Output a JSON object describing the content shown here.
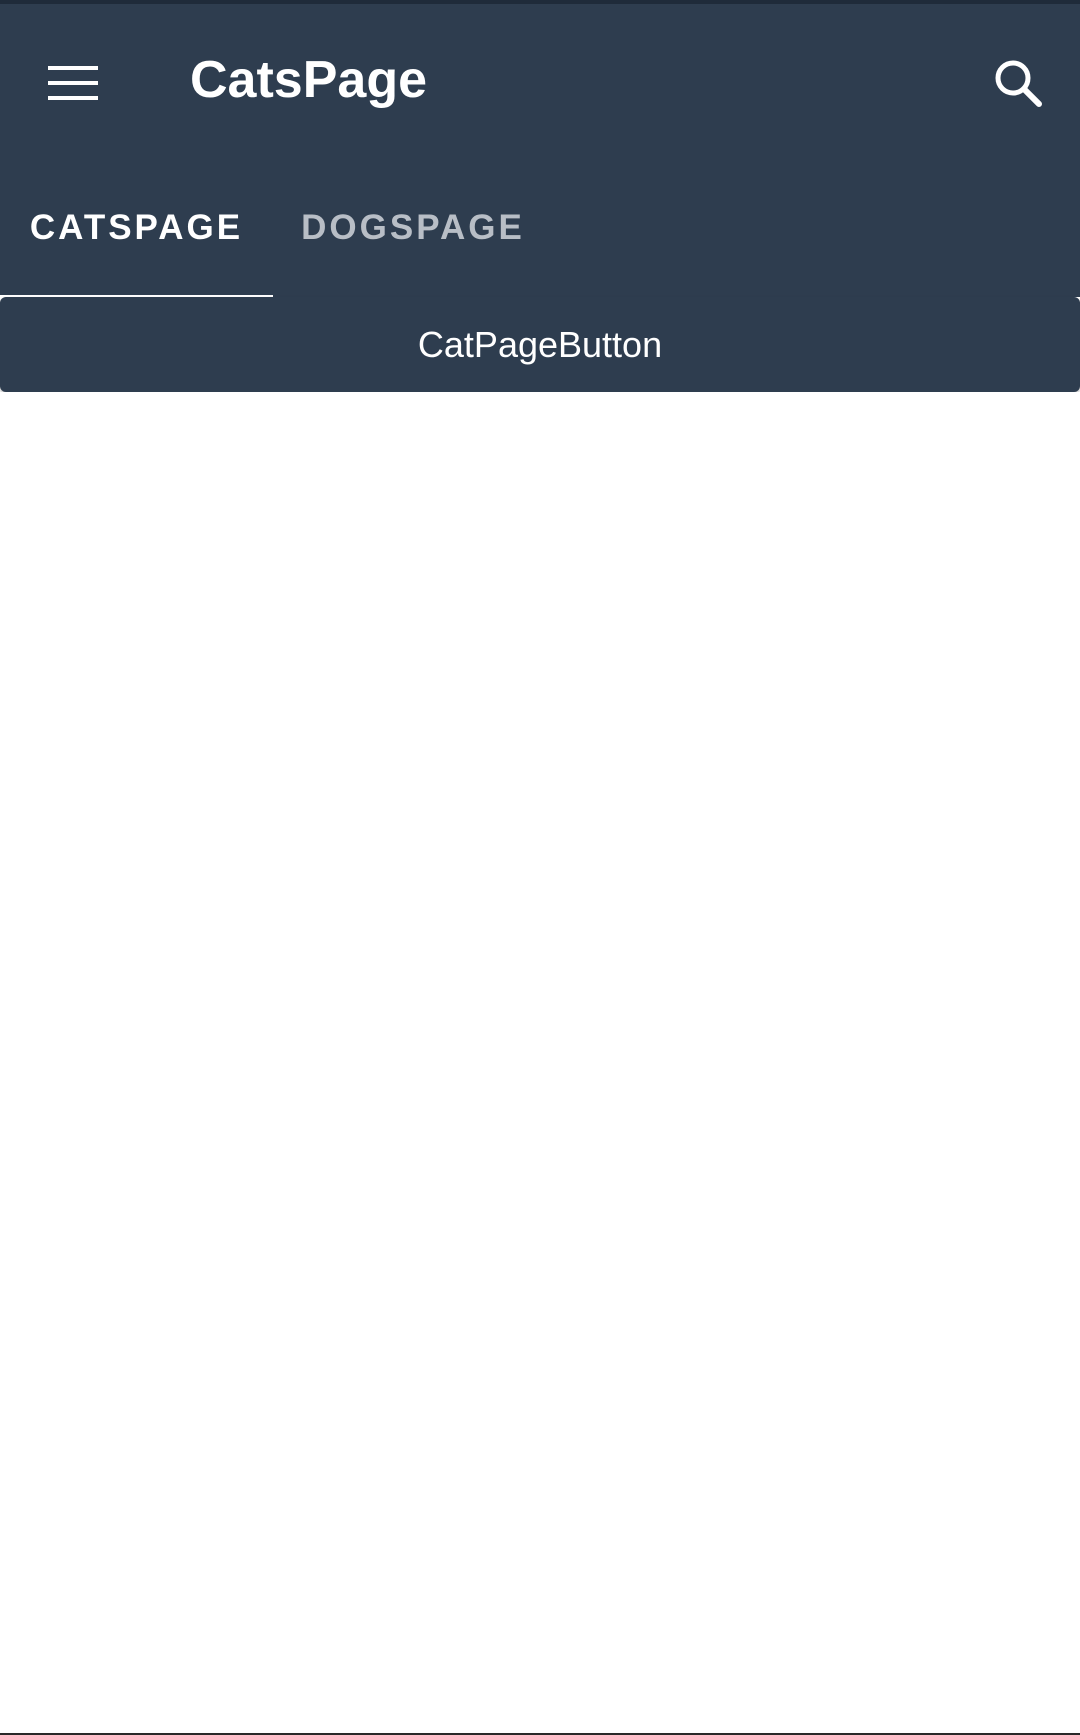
{
  "toolbar": {
    "title": "CatsPage",
    "menu_icon": "hamburger-menu-icon",
    "search_icon": "search-icon"
  },
  "tabs": [
    {
      "label": "CATSPAGE",
      "selected": true
    },
    {
      "label": "DOGSPAGE",
      "selected": false
    }
  ],
  "content": {
    "button_label": "CatPageButton"
  },
  "colors": {
    "appbar": "#2e3d4f",
    "text_primary": "#ffffff",
    "tab_unselected": "#b8bec6",
    "background": "#ffffff"
  }
}
